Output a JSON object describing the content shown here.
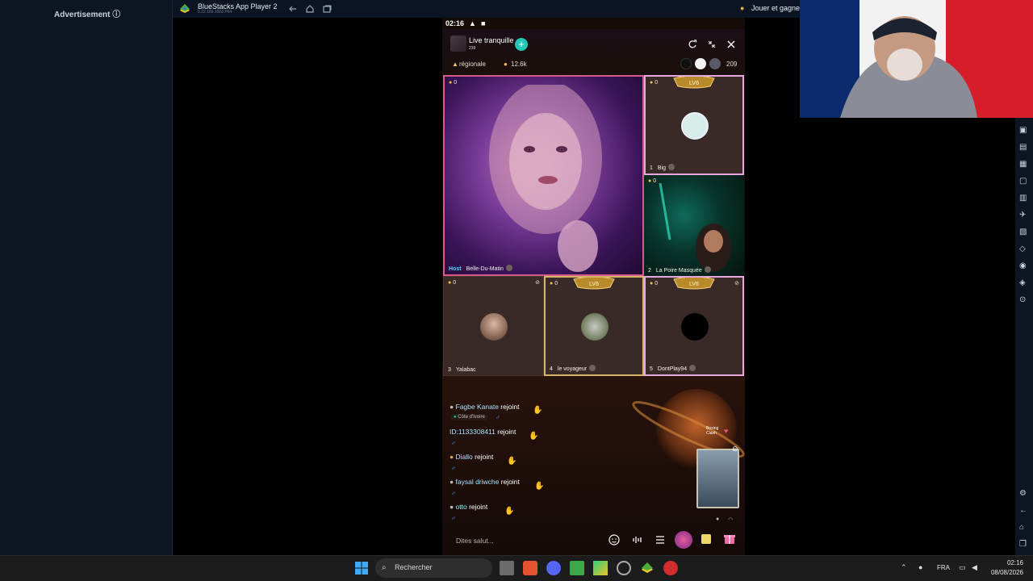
{
  "ad": {
    "label": "Advertisement ⓘ"
  },
  "bluestacks": {
    "title": "BlueStacks App Player 2",
    "version": "5.22.166.1003 P64",
    "promo": "Jouer et gagner"
  },
  "status_bar": {
    "time": "02:16"
  },
  "room": {
    "name": "Live tranquille",
    "sub": "239",
    "follow_label": "+",
    "region": "régionale",
    "coins": "12.6k",
    "viewer_count": "209"
  },
  "seats": [
    {
      "coins": "0",
      "host_tag": "Host",
      "name": "Belle-Du-Matin"
    },
    {
      "coins": "0",
      "number": "1",
      "name": "Big"
    },
    {
      "coins": "0",
      "number": "2",
      "name": "La Poire Masquée"
    },
    {
      "coins": "0",
      "number": "3",
      "name": "Yalabac"
    },
    {
      "coins": "0",
      "number": "4",
      "name": "le voyageur"
    },
    {
      "coins": "0",
      "number": "5",
      "name": "DontPlay94"
    }
  ],
  "level_badge": "LV6",
  "chat": [
    {
      "name": "Fagbe Kanate",
      "action": "rejoint",
      "tag": "Côte d'Ivoire"
    },
    {
      "name": "ID:1133308411",
      "action": "rejoint"
    },
    {
      "name": "Diallo",
      "action": "rejoint"
    },
    {
      "name": "faysal driwche",
      "action": "rejoint"
    },
    {
      "name": "otto",
      "action": "rejoint"
    }
  ],
  "promo_card": {
    "label": "Boxing Clash"
  },
  "input": {
    "placeholder": "Dites salut..."
  },
  "taskbar": {
    "search": "Rechercher",
    "lang": "FRA",
    "time": "02:16",
    "date": "08/08/2026"
  }
}
